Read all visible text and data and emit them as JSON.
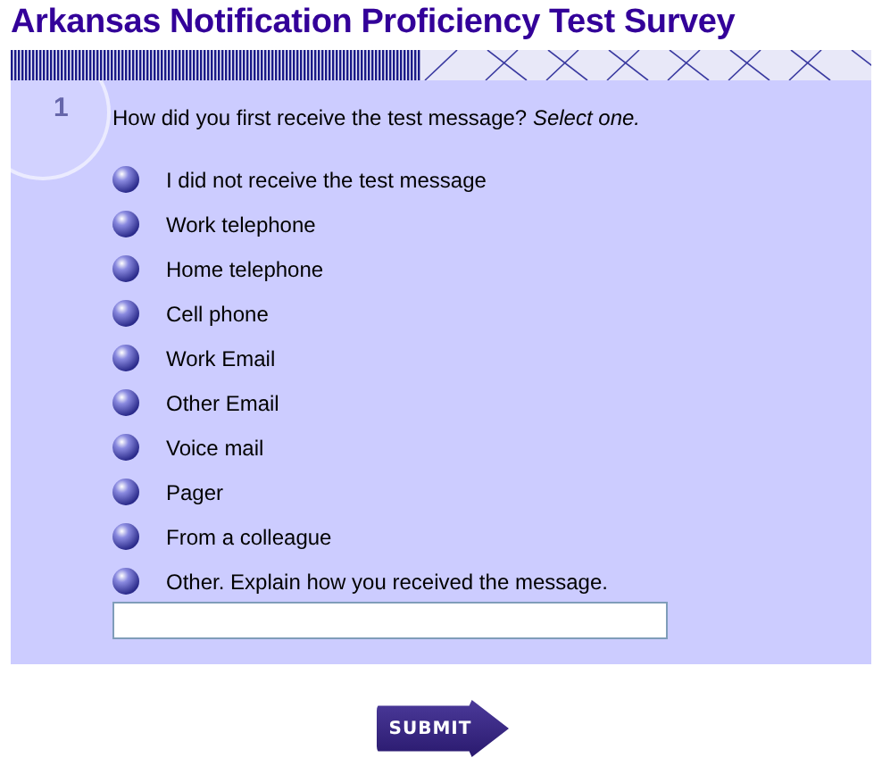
{
  "title": "Arkansas Notification Proficiency Test Survey",
  "question": {
    "number": "1",
    "text": "How did you first receive the test message? *Select one.*",
    "options": [
      {
        "label": "I did not receive the test message",
        "selected": false
      },
      {
        "label": "Work telephone",
        "selected": false
      },
      {
        "label": "Home telephone",
        "selected": false
      },
      {
        "label": "Cell phone",
        "selected": false
      },
      {
        "label": "Work Email",
        "selected": false
      },
      {
        "label": "Other Email",
        "selected": false
      },
      {
        "label": "Voice mail",
        "selected": false
      },
      {
        "label": "Pager",
        "selected": false
      },
      {
        "label": "From a colleague",
        "selected": false
      },
      {
        "label": "Other. Explain how you received the message.",
        "selected": false
      }
    ]
  },
  "submit": "SUBMIT"
}
